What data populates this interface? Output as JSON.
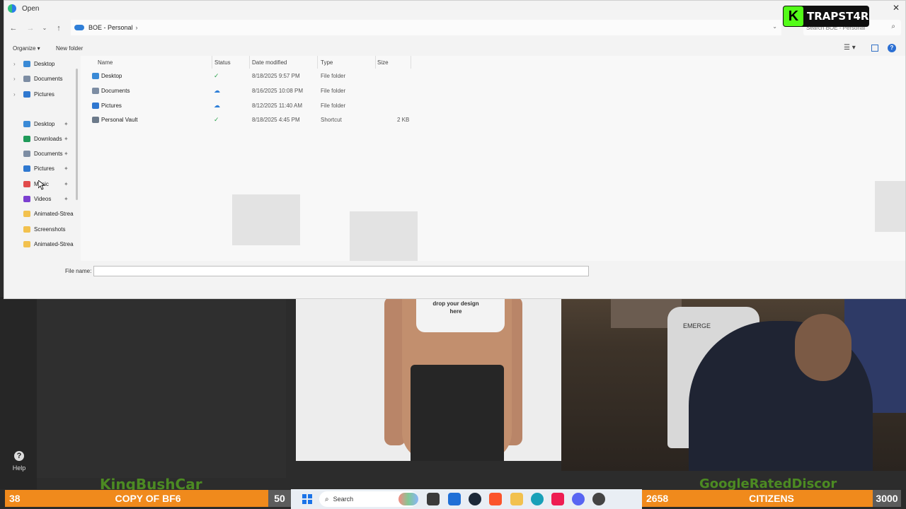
{
  "stream": {
    "tag_letter": "K",
    "tag_name": "TRAPST4R"
  },
  "dialog": {
    "title": "Open",
    "close_glyph": "✕",
    "address": {
      "crumb": "BOE - Personal",
      "separator": "›"
    },
    "search_placeholder": "Search BOE - Personal",
    "toolbar": {
      "organize_label": "Organize ▾",
      "new_folder_label": "New folder"
    },
    "nav_pane": {
      "tree": [
        {
          "label": "Desktop",
          "color": "#3a8ad6"
        },
        {
          "label": "Documents",
          "color": "#7d8da3"
        },
        {
          "label": "Pictures",
          "color": "#2f78d0"
        }
      ],
      "quick_access": [
        {
          "label": "Desktop",
          "color": "#3a8ad6",
          "pinned": true
        },
        {
          "label": "Downloads",
          "color": "#1f9a59",
          "pinned": true
        },
        {
          "label": "Documents",
          "color": "#7d8da3",
          "pinned": true
        },
        {
          "label": "Pictures",
          "color": "#2f78d0",
          "pinned": true
        },
        {
          "label": "Music",
          "color": "#e14b4b",
          "pinned": true
        },
        {
          "label": "Videos",
          "color": "#7b3fd0",
          "pinned": true
        },
        {
          "label": "Animated-Strea",
          "color": "#f2c14e",
          "pinned": false
        },
        {
          "label": "Screenshots",
          "color": "#f2c14e",
          "pinned": false
        },
        {
          "label": "Animated-Strea",
          "color": "#f2c14e",
          "pinned": false
        }
      ]
    },
    "columns": {
      "name": "Name",
      "status": "Status",
      "date_modified": "Date modified",
      "type": "Type",
      "size": "Size"
    },
    "files": [
      {
        "name": "Desktop",
        "status": "synced",
        "date": "8/18/2025 9:57 PM",
        "type": "File folder",
        "size": "",
        "color": "#3a8ad6"
      },
      {
        "name": "Documents",
        "status": "cloud",
        "date": "8/16/2025 10:08 PM",
        "type": "File folder",
        "size": "",
        "color": "#7d8da3"
      },
      {
        "name": "Pictures",
        "status": "cloud",
        "date": "8/12/2025 11:40 AM",
        "type": "File folder",
        "size": "",
        "color": "#2f78d0"
      },
      {
        "name": "Personal Vault",
        "status": "synced",
        "date": "8/18/2025 4:45 PM",
        "type": "Shortcut",
        "size": "2 KB",
        "color": "#6c7a8a"
      }
    ],
    "file_name_label": "File name:",
    "file_name_value": ""
  },
  "background_app": {
    "help_label": "Help",
    "mockup_text": "drop your design here"
  },
  "webcam": {
    "chair_label": "EMERGE"
  },
  "bottom_bars": {
    "left": {
      "number": "38",
      "label": "COPY OF BF6",
      "right_number": "50",
      "overlay_name": "KingBushCar"
    },
    "right": {
      "number": "2658",
      "label": "CITIZENS",
      "right_number": "3000",
      "overlay_name": "GoogleRatedDiscor"
    }
  },
  "taskbar": {
    "search_label": "Search"
  },
  "colors": {
    "accent": "#0067c0",
    "stat_bar": "#f08a1c",
    "synced": "#2ea44f",
    "cloud": "#2f7fd8"
  }
}
